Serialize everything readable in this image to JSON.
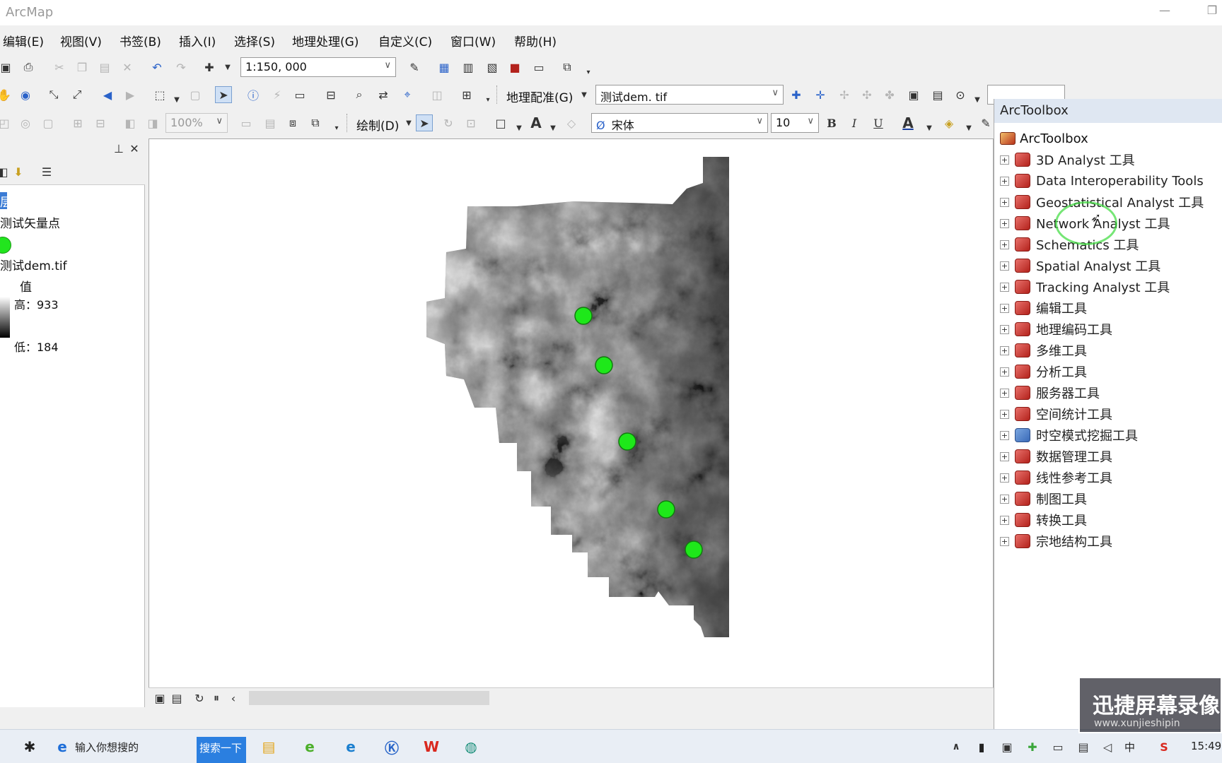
{
  "window": {
    "title": "ArcMap"
  },
  "menu": [
    "编辑(E)",
    "视图(V)",
    "书签(B)",
    "插入(I)",
    "选择(S)",
    "地理处理(G)",
    "自定义(C)",
    "窗口(W)",
    "帮助(H)"
  ],
  "toolbar": {
    "scale_value": "1:150, 000",
    "georef_label": "地理配准(G)",
    "georef_layer": "测试dem. tif",
    "zoom_value": "100%",
    "draw_label": "绘制(D)",
    "font_name": "宋体",
    "font_size": "10",
    "bold": "B",
    "italic": "I",
    "underline": "U",
    "text_tool": "A",
    "font_color": "A"
  },
  "toc": {
    "partial_header": "层",
    "layer_points": "测试矢量点",
    "layer_dem": "测试dem.tif",
    "value_label": "值",
    "high_label": "高：933",
    "low_label": "低：184",
    "point_color": "#22e51e"
  },
  "map": {
    "points_color": "#1ee81a",
    "point_count": 5
  },
  "arctoolbox": {
    "title": "ArcToolbox",
    "root": "ArcToolbox",
    "items": [
      {
        "label": "3D Analyst 工具",
        "icon": "toolbox-red-icon"
      },
      {
        "label": "Data Interoperability Tools",
        "icon": "toolbox-red-icon"
      },
      {
        "label": "Geostatistical Analyst 工具",
        "icon": "toolbox-red-icon"
      },
      {
        "label": "Network Analyst 工具",
        "icon": "toolbox-red-icon"
      },
      {
        "label": "Schematics 工具",
        "icon": "toolbox-red-icon"
      },
      {
        "label": "Spatial Analyst 工具",
        "icon": "toolbox-red-icon"
      },
      {
        "label": "Tracking Analyst 工具",
        "icon": "toolbox-red-icon"
      },
      {
        "label": "编辑工具",
        "icon": "toolbox-red-icon"
      },
      {
        "label": "地理编码工具",
        "icon": "toolbox-red-icon"
      },
      {
        "label": "多维工具",
        "icon": "toolbox-red-icon"
      },
      {
        "label": "分析工具",
        "icon": "toolbox-red-icon"
      },
      {
        "label": "服务器工具",
        "icon": "toolbox-red-icon"
      },
      {
        "label": "空间统计工具",
        "icon": "toolbox-red-icon"
      },
      {
        "label": "时空模式挖掘工具",
        "icon": "toolbox-blue-icon"
      },
      {
        "label": "数据管理工具",
        "icon": "toolbox-red-icon"
      },
      {
        "label": "线性参考工具",
        "icon": "toolbox-red-icon"
      },
      {
        "label": "制图工具",
        "icon": "toolbox-red-icon"
      },
      {
        "label": "转换工具",
        "icon": "toolbox-red-icon"
      },
      {
        "label": "宗地结构工具",
        "icon": "toolbox-red-icon"
      }
    ]
  },
  "taskbar": {
    "search_placeholder": "输入你想搜的",
    "search_button": "搜索一下",
    "ime": "中",
    "time": "15:49"
  },
  "watermark": {
    "line1": "迅捷屏幕录像",
    "line2": "www.xunjieshipin"
  }
}
